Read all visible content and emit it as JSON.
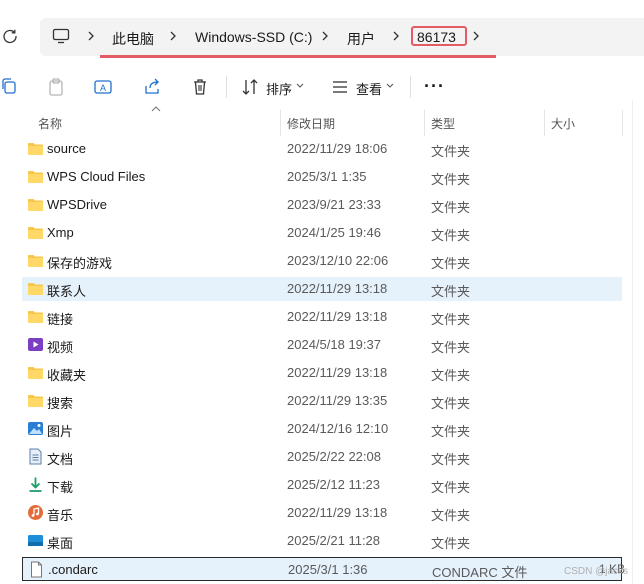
{
  "breadcrumb": {
    "items": [
      "此电脑",
      "Windows-SSD (C:)",
      "用户",
      "86173"
    ]
  },
  "toolbar": {
    "sort_label": "排序",
    "view_label": "查看",
    "more_label": "···"
  },
  "columns": {
    "name": "名称",
    "modified": "修改日期",
    "type": "类型",
    "size": "大小"
  },
  "files": [
    {
      "name": "source",
      "modified": "2022/11/29 18:06",
      "type": "文件夹",
      "icon": "folder-icon"
    },
    {
      "name": "WPS Cloud Files",
      "modified": "2025/3/1 1:35",
      "type": "文件夹",
      "icon": "folder-icon"
    },
    {
      "name": "WPSDrive",
      "modified": "2023/9/21 23:33",
      "type": "文件夹",
      "icon": "folder-icon"
    },
    {
      "name": "Xmp",
      "modified": "2024/1/25 19:46",
      "type": "文件夹",
      "icon": "folder-icon"
    },
    {
      "name": "保存的游戏",
      "modified": "2023/12/10 22:06",
      "type": "文件夹",
      "icon": "folder-icon"
    },
    {
      "name": "联系人",
      "modified": "2022/11/29 13:18",
      "type": "文件夹",
      "icon": "folder-icon",
      "selected": true
    },
    {
      "name": "链接",
      "modified": "2022/11/29 13:18",
      "type": "文件夹",
      "icon": "folder-icon"
    },
    {
      "name": "视频",
      "modified": "2024/5/18 19:37",
      "type": "文件夹",
      "icon": "videos-folder-icon"
    },
    {
      "name": "收藏夹",
      "modified": "2022/11/29 13:18",
      "type": "文件夹",
      "icon": "folder-icon"
    },
    {
      "name": "搜索",
      "modified": "2022/11/29 13:35",
      "type": "文件夹",
      "icon": "folder-icon"
    },
    {
      "name": "图片",
      "modified": "2024/12/16 12:10",
      "type": "文件夹",
      "icon": "pictures-folder-icon"
    },
    {
      "name": "文档",
      "modified": "2025/2/22 22:08",
      "type": "文件夹",
      "icon": "documents-folder-icon"
    },
    {
      "name": "下载",
      "modified": "2025/2/12 11:23",
      "type": "文件夹",
      "icon": "downloads-folder-icon"
    },
    {
      "name": "音乐",
      "modified": "2022/11/29 13:18",
      "type": "文件夹",
      "icon": "music-folder-icon"
    },
    {
      "name": "桌面",
      "modified": "2025/2/21 11:28",
      "type": "文件夹",
      "icon": "desktop-folder-icon"
    },
    {
      "name": ".condarc",
      "modified": "2025/3/1 1:36",
      "type": "CONDARC 文件",
      "size": "1 KB",
      "icon": "file-icon",
      "focused": true
    }
  ],
  "watermark": "CSDN @jacks",
  "colors": {
    "highlight_red": "#e35b64",
    "folder_yellow": "#f8c64a",
    "selection_blue": "#e5f1fb"
  }
}
